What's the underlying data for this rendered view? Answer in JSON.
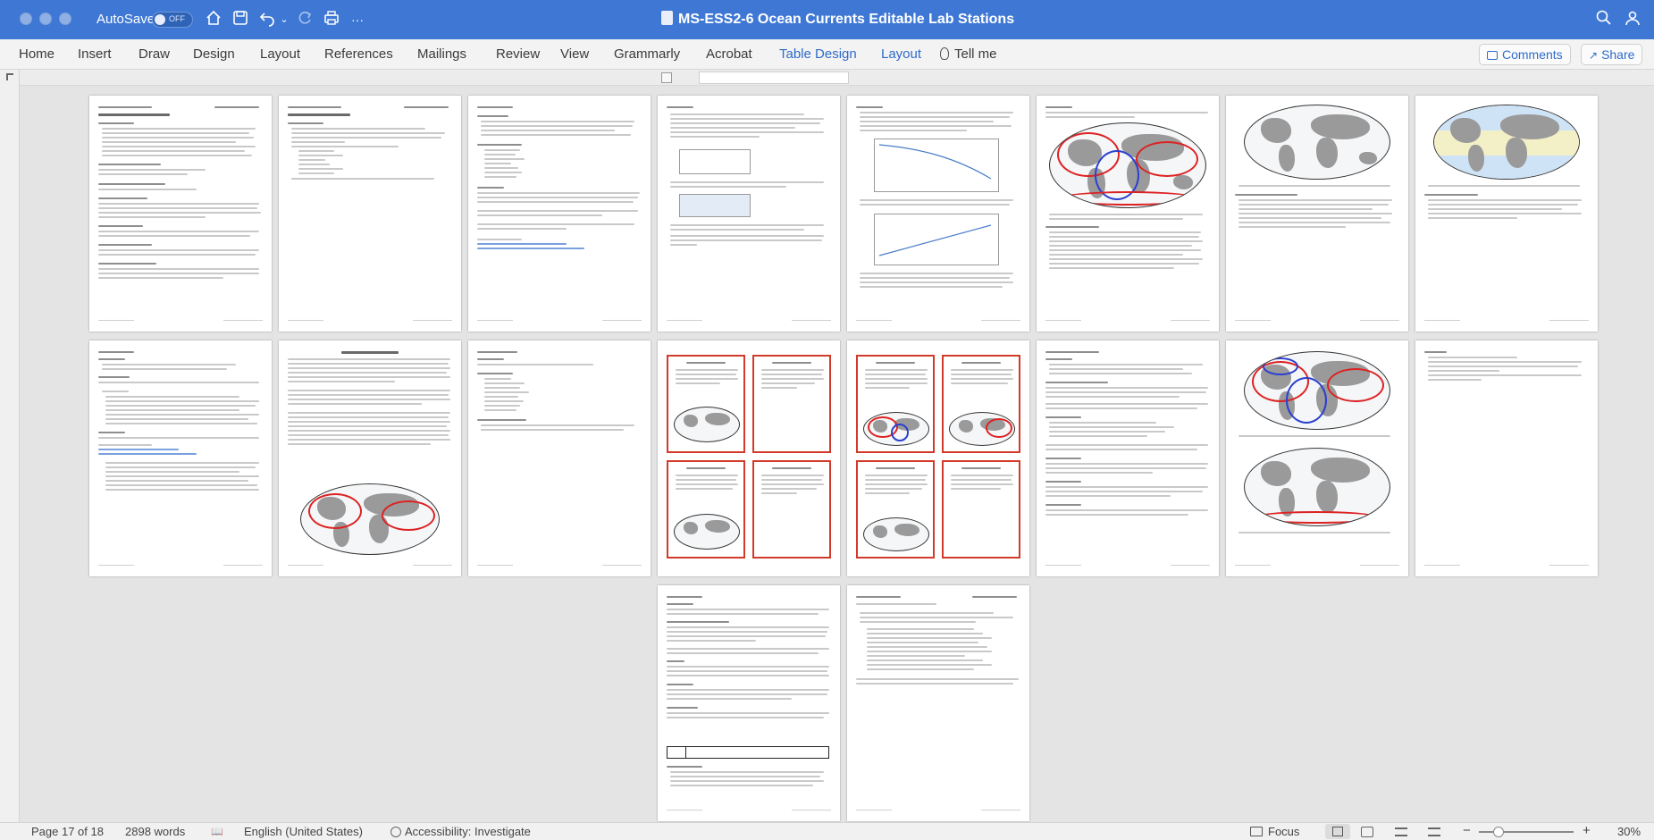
{
  "titlebar": {
    "autosave_label": "AutoSave",
    "autosave_state": "OFF",
    "home_icon": "home-icon",
    "save_icon": "save-icon",
    "undo_icon": "undo-icon",
    "redo_icon": "redo-icon",
    "print_icon": "print-icon",
    "more_icon": "more-icon",
    "more_glyph": "···",
    "document_title": "MS-ESS2-6 Ocean Currents Editable Lab Stations",
    "search_icon": "search-icon"
  },
  "ribbon": {
    "tabs": [
      "Home",
      "Insert",
      "Draw",
      "Design",
      "Layout",
      "References",
      "Mailings",
      "Review",
      "View",
      "Grammarly",
      "Acrobat",
      "Table Design",
      "Layout"
    ],
    "tell_me": "Tell me",
    "comments_label": "Comments",
    "share_label": "Share"
  },
  "statusbar": {
    "page_info": "Page 17 of 18",
    "word_count": "2898 words",
    "language": "English (United States)",
    "accessibility": "Accessibility: Investigate",
    "focus_label": "Focus",
    "zoom_minus": "−",
    "zoom_plus": "+",
    "zoom_level": "30%"
  }
}
